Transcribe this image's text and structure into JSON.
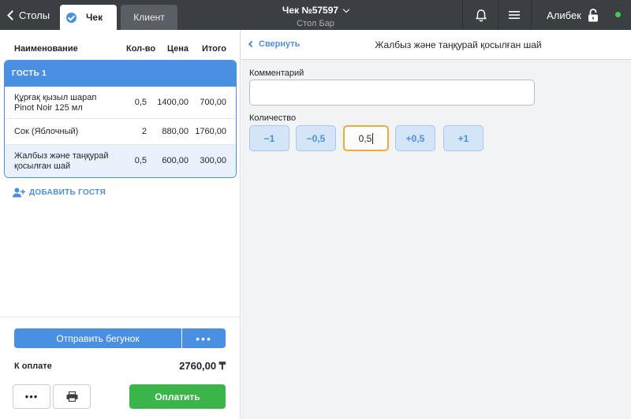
{
  "topbar": {
    "back_label": "Столы",
    "tabs": [
      {
        "label": "Чек",
        "active": true
      },
      {
        "label": "Клиент",
        "active": false
      }
    ],
    "title": "Чек №57597",
    "subtitle": "Стол Бар",
    "user_name": "Алибек",
    "status_color": "#3ecf4a"
  },
  "order": {
    "columns": {
      "name": "Наименование",
      "qty": "Кол-во",
      "price": "Цена",
      "total": "Итого"
    },
    "guest_label": "ГОСТЬ 1",
    "items": [
      {
        "name": "Құрғақ қызыл шарап Pinot Noir 125 мл",
        "qty": "0,5",
        "price": "1400,00",
        "total": "700,00"
      },
      {
        "name": "Сок (Яблочный)",
        "qty": "2",
        "price": "880,00",
        "total": "1760,00"
      },
      {
        "name": "Жалбыз және таңқурай қосылған шай",
        "qty": "0,5",
        "price": "600,00",
        "total": "300,00",
        "selected": true
      }
    ],
    "add_guest_label": "ДОБАВИТЬ ГОСТЯ",
    "send_label": "Отправить бегунок",
    "more_label": "•••",
    "pay_label": "К оплате",
    "pay_amount": "2760,00 ₸",
    "dots_label": "•••",
    "pay_button_label": "Оплатить"
  },
  "detail": {
    "collapse_label": "Свернуть",
    "item_title": "Жалбыз және таңқурай қосылған шай",
    "comment_label": "Комментарий",
    "comment_value": "",
    "qty_label": "Количество",
    "qty_buttons": [
      "−1",
      "−0,5",
      "+0,5",
      "+1"
    ],
    "qty_value": "0,5"
  },
  "colors": {
    "accent": "#4a90e2",
    "pay_green": "#3bb54a",
    "topbar": "#3b3f44",
    "input_focus": "#f0a93b"
  },
  "icons": [
    "back-chevron-icon",
    "check-icon",
    "chevron-down-icon",
    "bell-icon",
    "menu-icon",
    "lock-icon",
    "add-user-icon",
    "printer-icon"
  ]
}
